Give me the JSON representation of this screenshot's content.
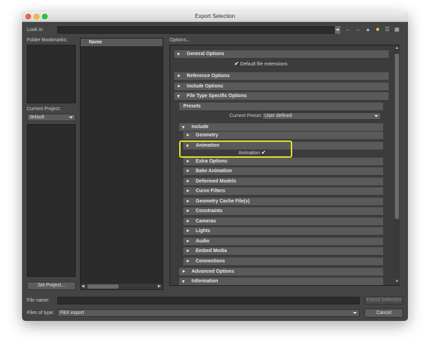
{
  "window": {
    "title": "Export Selection"
  },
  "look_in": {
    "label": "Look in:",
    "value": ""
  },
  "toolbar_icons": [
    "back-icon",
    "forward-icon",
    "up-folder-icon",
    "new-folder-icon",
    "list-view-icon",
    "detail-view-icon"
  ],
  "folder_bookmarks": {
    "label": "Folder Bookmarks:"
  },
  "current_project": {
    "label": "Current Project:",
    "value": "default"
  },
  "set_project_label": "Set Project...",
  "file_list": {
    "column_header": "Name"
  },
  "options": {
    "label": "Options...",
    "general": {
      "label": "General Options",
      "default_ext_label": "Default file extensions",
      "default_ext_checked": true
    },
    "reference": {
      "label": "Reference Options"
    },
    "include_opts": {
      "label": "Include Options"
    },
    "file_type": {
      "label": "File Type Specific Options"
    },
    "presets": {
      "label": "Presets",
      "current_preset_label": "Current Preset:",
      "current_preset_value": "User defined"
    },
    "include": {
      "label": "Include",
      "geometry": "Geometry",
      "animation": {
        "label": "Animation",
        "checkbox_label": "Animation",
        "checked": true
      },
      "extra": "Extra Options",
      "bake": "Bake Animation",
      "deformed": "Deformed Models",
      "curve_filters": "Curve Filters",
      "geometry_cache": "Geometry Cache File(s)",
      "constraints": "Constraints",
      "cameras": "Cameras",
      "lights": "Lights",
      "audio": "Audio",
      "embed_media": "Embed Media",
      "connections": "Connections"
    },
    "advanced": {
      "label": "Advanced Options"
    },
    "information": {
      "label": "Information"
    }
  },
  "file_name": {
    "label": "File name:",
    "value": ""
  },
  "files_of_type": {
    "label": "Files of type:",
    "value": "FBX export"
  },
  "buttons": {
    "export": "Export Selection",
    "cancel": "Cancel"
  },
  "colors": {
    "window_bg": "#444444",
    "panel_bg": "#2b2b2b",
    "bar_bg": "#5a5a5a",
    "highlight": "#e6e62a"
  }
}
